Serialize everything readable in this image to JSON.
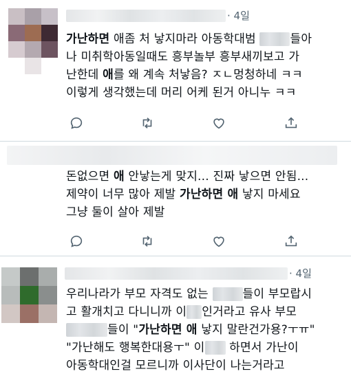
{
  "tweets": [
    {
      "time": "· 4일",
      "lines": [
        {
          "before": "",
          "bold": "가난하면",
          "after": " 애좀 처 낳지마라 아동학대범 "
        },
        {
          "before": "",
          "bold": "",
          "after": "나 미취학아동일때도 흥부놀부 흥부새끼보고 가"
        },
        {
          "before": "난한데 ",
          "bold": "애",
          "after": "를 왜 계속 처낳음? ㅈㄴ멍청하네 ㅋㅋ"
        },
        {
          "before": "",
          "bold": "",
          "after": "이렇게 생각했는데 머리 어케 된거 아니누 ㅋㅋ"
        }
      ],
      "line1_tail": "들아"
    },
    {
      "time": "",
      "lines": [
        {
          "before": "돈없으면 ",
          "bold": "애",
          "after": " 안낳는게 맞지... 진짜 낳으면 안됨..."
        },
        {
          "before": "제약이 너무 많아 제발 ",
          "bold": "가난하면 애",
          "after": " 낳지 마세요"
        },
        {
          "before": "그냥 둘이 살아 제발",
          "bold": "",
          "after": ""
        }
      ]
    },
    {
      "time": "· 4일",
      "lines": [
        {
          "a": "우리나라가 부모 자격도 없는 ",
          "b": "들이 부모랍시"
        },
        {
          "a": "고 활개치고 다니니까 이",
          "b": "인거라고 유사 부모"
        },
        {
          "a": "",
          "b": "들이 \"",
          "bold": "가난하면 애",
          "c": " 낳지 말란건가용?ㅜㅠ\""
        },
        {
          "a": "\"가난해도 행복한대용ㅜ\" 이",
          "b": " 하면서 가난이"
        },
        {
          "a": "아동학대인걸 모르니까 이사단이 나는거라고",
          "b": ""
        }
      ]
    }
  ],
  "actions": {
    "reply": "reply-icon",
    "retweet": "retweet-icon",
    "like": "heart-icon",
    "share": "share-icon"
  }
}
